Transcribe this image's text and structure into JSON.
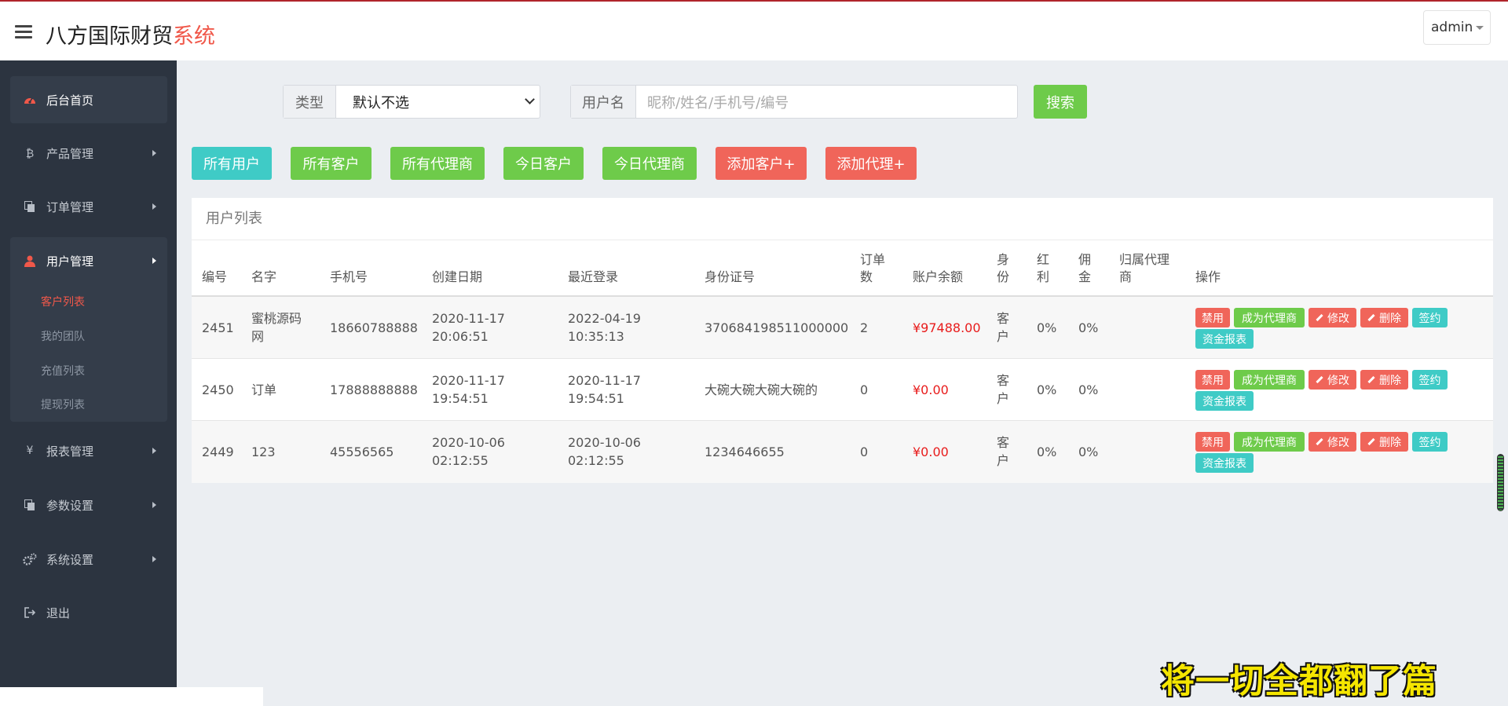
{
  "header": {
    "brand_main": "八方国际财贸",
    "brand_highlight": "系统",
    "user": "admin"
  },
  "sidebar": {
    "items": [
      {
        "label": "后台首页",
        "icon": "dashboard-icon"
      },
      {
        "label": "产品管理",
        "icon": "bitcoin-icon"
      },
      {
        "label": "订单管理",
        "icon": "copy-icon"
      },
      {
        "label": "用户管理",
        "icon": "user-icon"
      },
      {
        "label": "报表管理",
        "icon": "yen-icon"
      },
      {
        "label": "参数设置",
        "icon": "copy-icon"
      },
      {
        "label": "系统设置",
        "icon": "gears-icon"
      },
      {
        "label": "退出",
        "icon": "sign-out-icon"
      }
    ],
    "subitems": [
      "客户列表",
      "我的团队",
      "充值列表",
      "提现列表"
    ]
  },
  "search": {
    "type_label": "类型",
    "type_value": "默认不选",
    "user_label": "用户名",
    "user_placeholder": "昵称/姓名/手机号/编号",
    "search_button": "搜索"
  },
  "filters": [
    "所有用户",
    "所有客户",
    "所有代理商",
    "今日客户",
    "今日代理商",
    "添加客户+",
    "添加代理+"
  ],
  "table": {
    "title": "用户列表",
    "headers": {
      "id": "编号",
      "name": "名字",
      "phone": "手机号",
      "created": "创建日期",
      "login": "最近登录",
      "idcard": "身份证号",
      "orders_1": "订单",
      "orders_2": "数",
      "balance": "账户余额",
      "role_1": "身",
      "role_2": "份",
      "bonus_1": "红",
      "bonus_2": "利",
      "comm_1": "佣",
      "comm_2": "金",
      "agent_1": "归属代理",
      "agent_2": "商",
      "ops": "操作"
    },
    "rows": [
      {
        "id": "2451",
        "name_1": "蜜桃源码",
        "name_2": "网",
        "phone": "18660788888",
        "created_date": "2020-11-17",
        "created_time": "20:06:51",
        "login_date": "2022-04-19",
        "login_time": "10:35:13",
        "idcard": "370684198511000000",
        "orders": "2",
        "balance": "¥97488.00",
        "role_1": "客",
        "role_2": "户",
        "bonus": "0%",
        "comm": "0%",
        "agent": ""
      },
      {
        "id": "2450",
        "name_1": "订单",
        "name_2": "",
        "phone": "17888888888",
        "created_date": "2020-11-17",
        "created_time": "19:54:51",
        "login_date": "2020-11-17",
        "login_time": "19:54:51",
        "idcard": "大碗大碗大碗大碗的",
        "orders": "0",
        "balance": "¥0.00",
        "role_1": "客",
        "role_2": "户",
        "bonus": "0%",
        "comm": "0%",
        "agent": ""
      },
      {
        "id": "2449",
        "name_1": "123",
        "name_2": "",
        "phone": "45556565",
        "created_date": "2020-10-06",
        "created_time": "02:12:55",
        "login_date": "2020-10-06",
        "login_time": "02:12:55",
        "idcard": "1234646655",
        "orders": "0",
        "balance": "¥0.00",
        "role_1": "客",
        "role_2": "户",
        "bonus": "0%",
        "comm": "0%",
        "agent": ""
      }
    ],
    "actions": {
      "disable": "禁用",
      "make_agent": "成为代理商",
      "edit": "修改",
      "delete": "删除",
      "sign": "签约",
      "report": "资金报表"
    }
  },
  "overlay_text": "将一切全都翻了篇",
  "colors": {
    "accent_red": "#f0584a",
    "teal": "#3fcbc6",
    "green": "#6ecb4a",
    "sidebar_bg": "#2c3440",
    "money_red": "#e81c1c"
  }
}
